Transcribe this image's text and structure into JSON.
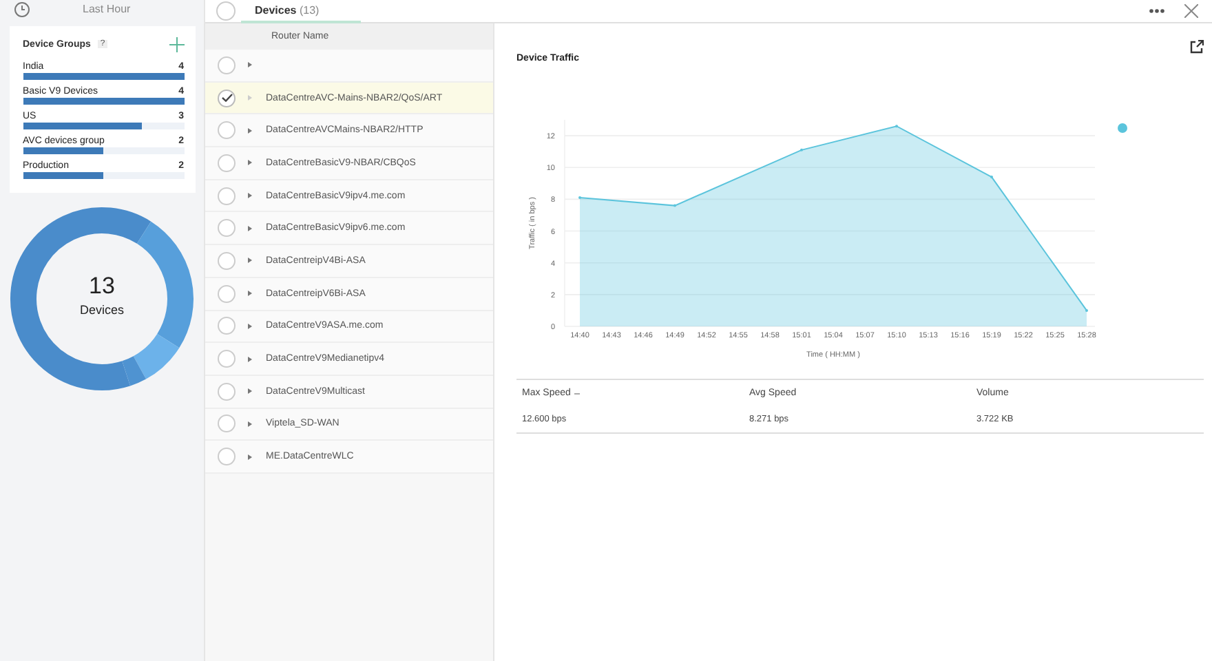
{
  "top_bar": {
    "time_range": "Last Hour",
    "all_selected": false
  },
  "tabs": [
    {
      "label": "Devices",
      "count": "(13)",
      "selected": true
    }
  ],
  "device_groups": {
    "title": "Device Groups",
    "help": "?",
    "items": [
      {
        "name": "India",
        "count": "4",
        "level": 1
      },
      {
        "name": "Basic V9 Devices",
        "count": "4",
        "level": 1
      },
      {
        "name": "US",
        "count": "3",
        "level": 0.74
      },
      {
        "name": "AVC devices group",
        "count": "2",
        "level": 0.5
      },
      {
        "name": "Production",
        "count": "2",
        "level": 0.5
      }
    ]
  },
  "donut": {
    "total": "13",
    "label": "Devices"
  },
  "router_table": {
    "column": "Router Name",
    "rows": [
      {
        "selected": false
      },
      {
        "name": "DataCentreAVC-Mains-NBAR2/QoS/ART",
        "selected": true
      },
      {
        "name": "DataCentreAVCMains-NBAR2/HTTP",
        "selected": false
      },
      {
        "name": "DataCentreBasicV9-NBAR/CBQoS",
        "selected": false
      },
      {
        "name": "DataCentreBasicV9ipv4.me.com",
        "selected": false
      },
      {
        "name": "DataCentreBasicV9ipv6.me.com",
        "selected": false
      },
      {
        "name": "DataCentreipV4Bi-ASA",
        "selected": false
      },
      {
        "name": "DataCentreipV6Bi-ASA",
        "selected": false
      },
      {
        "name": "DataCentreV9ASA.me.com",
        "selected": false
      },
      {
        "name": "DataCentreV9Medianetipv4",
        "selected": false
      },
      {
        "name": "DataCentreV9Multicast",
        "selected": false
      },
      {
        "name": "Viptela_SD-WAN",
        "selected": false
      },
      {
        "name": "ME.DataCentreWLC",
        "selected": false
      }
    ]
  },
  "detail": {
    "title": "Device Traffic",
    "chart_data": {
      "type": "area",
      "xlabel": "Time ( HH:MM )",
      "ylabel": "Traffic ( in bps )",
      "categories": [
        "14:40",
        "14:43",
        "14:46",
        "14:49",
        "14:52",
        "14:55",
        "14:58",
        "15:01",
        "15:04",
        "15:07",
        "15:10",
        "15:13",
        "15:16",
        "15:19",
        "15:22",
        "15:25",
        "15:28"
      ],
      "series": [
        {
          "color": "#5bc4dc",
          "values": [
            8.1,
            null,
            null,
            7.6,
            null,
            null,
            null,
            11.1,
            null,
            null,
            12.6,
            null,
            null,
            9.4,
            null,
            null,
            1.0
          ]
        }
      ],
      "grid": true,
      "ylim": [
        0,
        13
      ],
      "yticks": [
        0,
        2,
        4,
        6,
        8,
        10,
        12
      ]
    },
    "stats": {
      "columns": [
        "Max Speed",
        "Avg Speed",
        "Volume"
      ],
      "values": [
        "12.600 bps",
        "8.271 bps",
        "3.722 KB"
      ]
    }
  }
}
